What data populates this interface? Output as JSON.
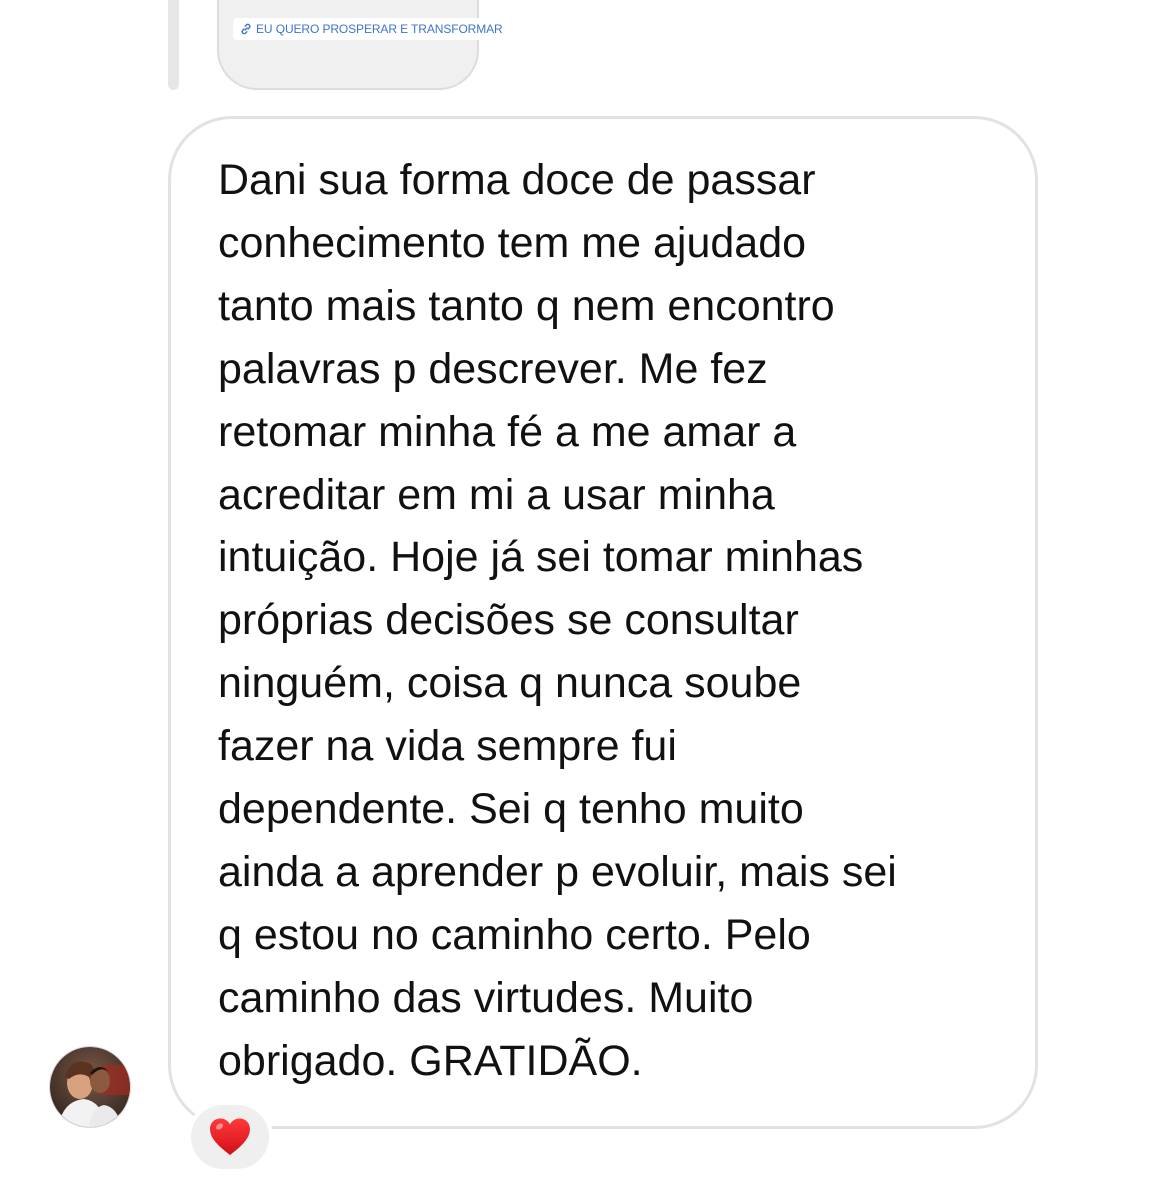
{
  "story_reply": {
    "link_sticker_label": "EU QUERO PROSPERAR E TRANSFORMAR",
    "link_icon": "link-icon"
  },
  "message": {
    "text": "Dani sua forma doce de passar\nconhecimento tem me ajudado\ntanto mais tanto q nem encontro\npalavras p descrever. Me fez\nretomar minha fé a me amar a\nacreditar em mi a usar minha\nintuição. Hoje já sei tomar minhas\npróprias decisões se consultar\nninguém, coisa q nunca soube\nfazer na vida sempre fui\ndependente. Sei q tenho muito\nainda a aprender p evoluir, mais sei\nq estou no caminho certo. Pelo\ncaminho das virtudes. Muito\nobrigado. GRATIDÃO."
  },
  "reaction": {
    "icon": "heart-icon",
    "color": "#e0161e"
  },
  "sender_avatar": {
    "icon": "avatar"
  },
  "colors": {
    "bubble_border": "#e2e2e2",
    "link_text": "#3f74c9",
    "reaction_background": "#efefef"
  }
}
